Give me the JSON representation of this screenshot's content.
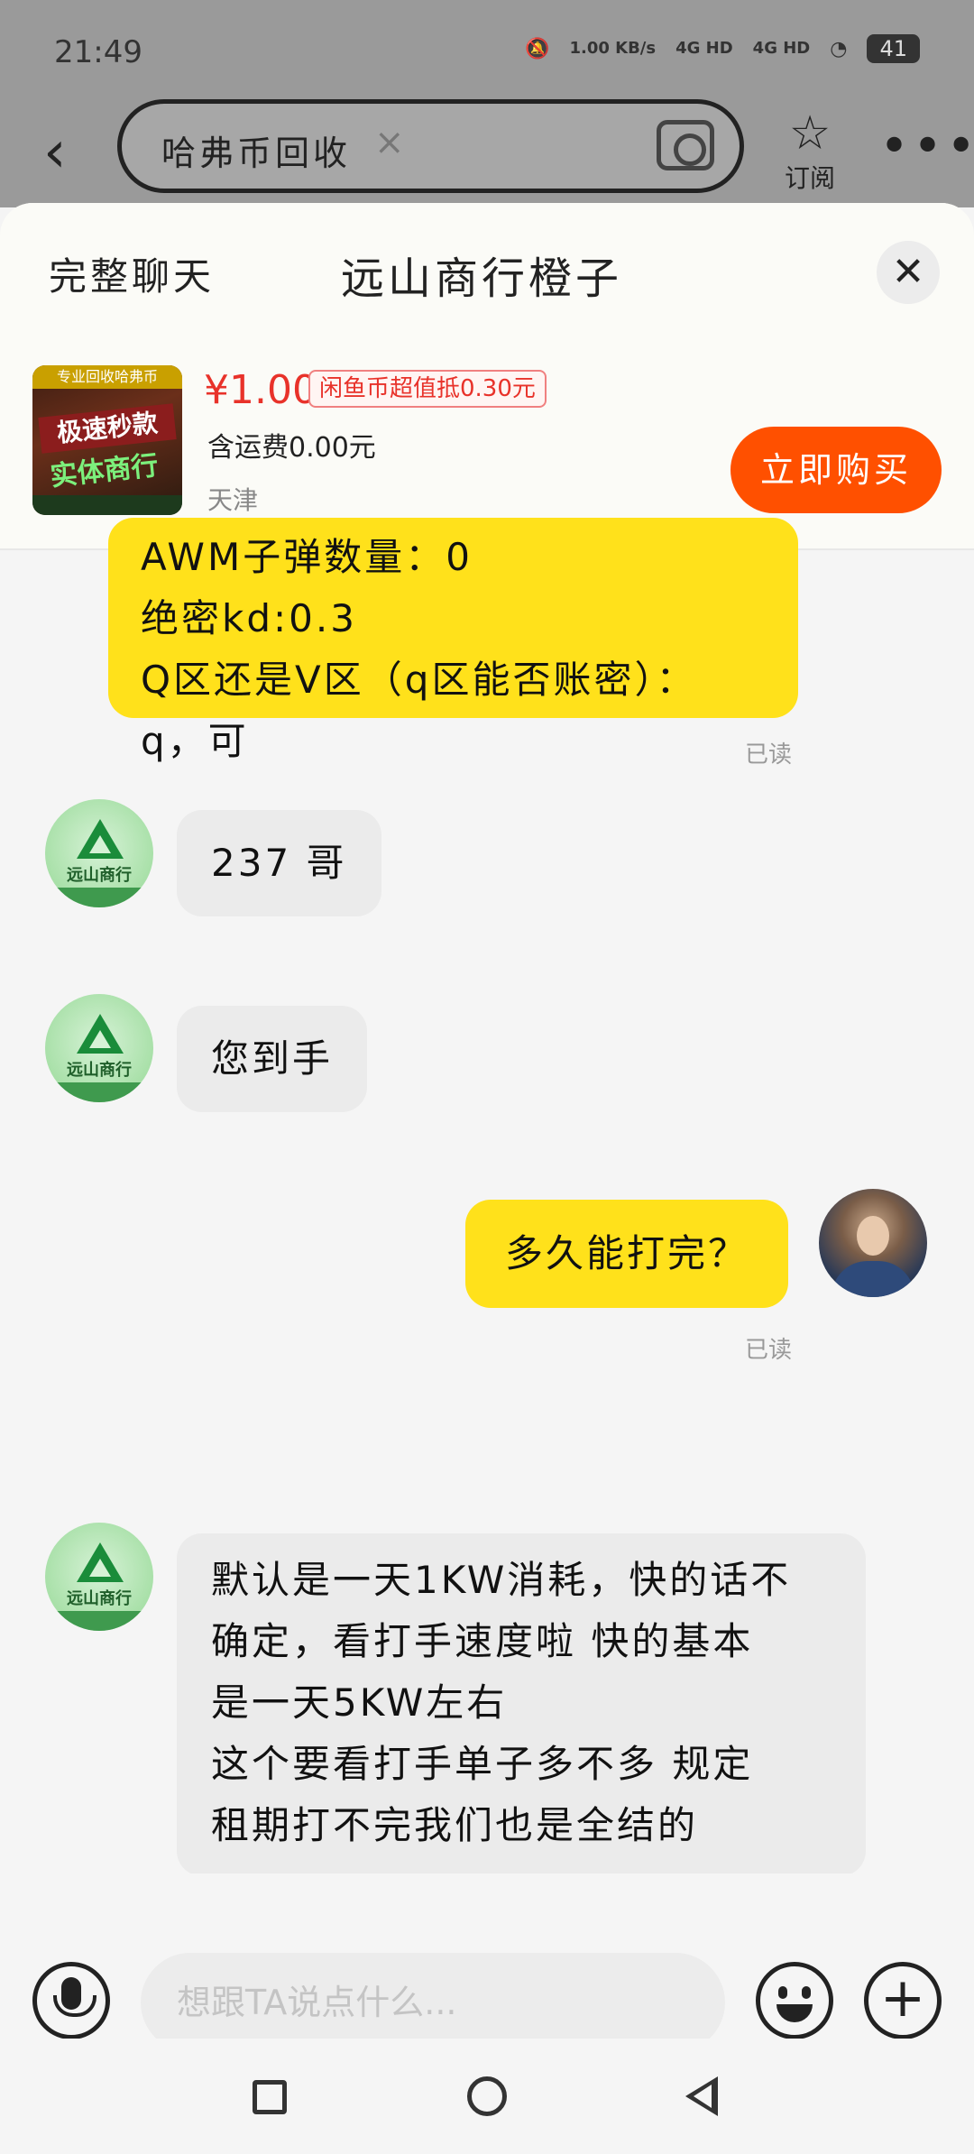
{
  "status_bar": {
    "time": "21:49",
    "net_speed": "1.00 KB/s",
    "signal_1": "4G HD",
    "signal_2": "4G HD",
    "battery": "41"
  },
  "search": {
    "query": "哈弗币回收",
    "subscribe_label": "订阅"
  },
  "sheet": {
    "full_chat_label": "完整聊天",
    "seller_name": "远山商行橙子"
  },
  "product": {
    "price": "¥1.00",
    "coupon": "闲鱼币超值抵0.30元",
    "shipping": "含运费0.00元",
    "location": "天津",
    "buy_label": "立即购买",
    "thumb_banner": "专业回收哈弗币",
    "thumb_line1": "极速秒款",
    "thumb_line2": "实体商行"
  },
  "avatar": {
    "shop_name": "远山商行"
  },
  "messages": [
    {
      "side": "mine",
      "lines": [
        "AWM子弹数量：0",
        "绝密kd:0.3",
        "Q区还是V区（q区能否账密）：",
        "q，可"
      ],
      "read": "已读"
    },
    {
      "side": "theirs",
      "text": "237 哥"
    },
    {
      "side": "theirs",
      "text": "您到手"
    },
    {
      "side": "mine",
      "text": "多久能打完？",
      "read": "已读"
    },
    {
      "side": "theirs",
      "lines": [
        "默认是一天1KW消耗，快的话不",
        "确定，看打手速度啦 快的基本",
        "是一天5KW左右",
        "这个要看打手单子多不多 规定",
        "租期打不完我们也是全结的"
      ]
    }
  ],
  "input": {
    "placeholder": "想跟TA说点什么..."
  },
  "colors": {
    "accent": "#ff5000",
    "price": "#e8322a",
    "mine_bubble": "#ffe11b",
    "theirs_bubble": "#ebebeb"
  }
}
